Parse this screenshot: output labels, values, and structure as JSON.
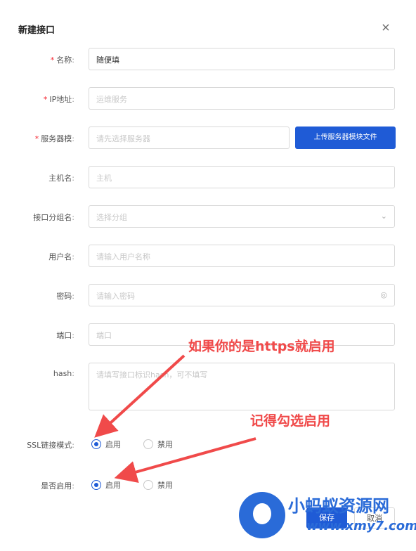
{
  "dialog": {
    "title": "新建接口",
    "close_symbol": "×"
  },
  "form": {
    "name": {
      "label": "名称",
      "required": true,
      "value": "随便填"
    },
    "ip": {
      "label": "IP地址",
      "required": true,
      "placeholder": "运维服务"
    },
    "server_module": {
      "label": "服务器模",
      "required": true,
      "placeholder": "请先选择服务器",
      "button_label": "上传服务器模块文件"
    },
    "hostname": {
      "label": "主机名",
      "required": false,
      "placeholder": "主机"
    },
    "group": {
      "label": "接口分组名",
      "required": false,
      "placeholder": "选择分组"
    },
    "username": {
      "label": "用户名",
      "required": false,
      "placeholder": "请输入用户名称"
    },
    "password": {
      "label": "密码",
      "required": false,
      "placeholder": "请输入密码"
    },
    "port": {
      "label": "端口",
      "required": false,
      "placeholder": "端口"
    },
    "hash": {
      "label": "hash",
      "required": false,
      "placeholder": "请填写接口标识hash，可不填写"
    },
    "ssl": {
      "label": "SSL链接模式",
      "options": [
        "启用",
        "禁用"
      ],
      "selected": "启用"
    },
    "enabled": {
      "label": "是否启用",
      "options": [
        "启用",
        "禁用"
      ],
      "selected": "启用"
    }
  },
  "annotations": {
    "top": "如果你的是https就启用",
    "bottom": "记得勾选启用"
  },
  "footer": {
    "save_label": "保存",
    "cancel_label": "取消"
  },
  "watermark": {
    "cn_text": "小蚂蚁资源网",
    "url_text": "www.xmy7.com"
  },
  "colors": {
    "primary": "#1f5bd6",
    "annotation": "#f04a4a",
    "required": "#f5222d"
  },
  "icons": {
    "close": "close-icon",
    "dropdown": "chevron-down-icon",
    "eye": "eye-icon"
  }
}
